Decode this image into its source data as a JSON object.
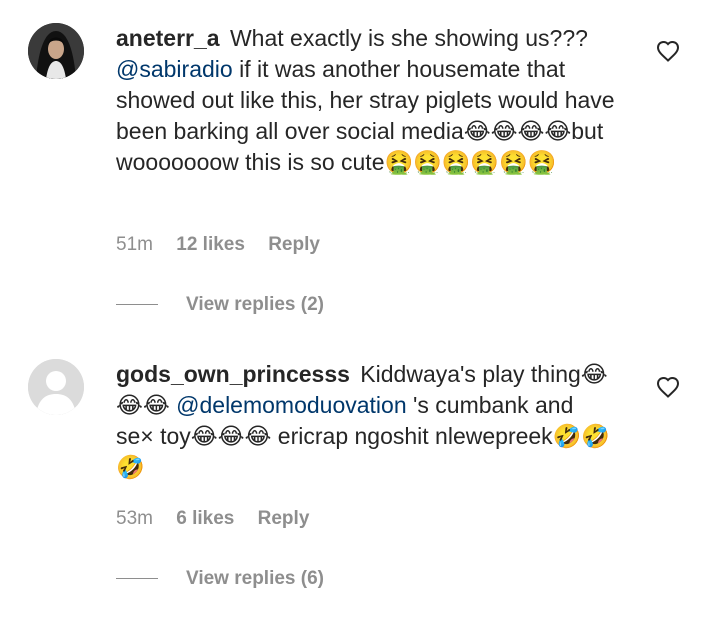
{
  "comments": [
    {
      "username": "aneterr_a",
      "text_before": " What exactly is she showing us??? ",
      "mention": "@sabiradio",
      "text_after": " if it was another housemate that showed out like this, her stray piglets would have been barking all over social media😂😂😂😂but wooooooow this is so cute🤮🤮🤮🤮🤮🤮",
      "time": "51m",
      "likes": "12 likes",
      "reply": "Reply",
      "view_replies": "View replies (2)"
    },
    {
      "username": "gods_own_princesss",
      "text_before": " Kiddwaya's play thing😂😂😂 ",
      "mention": "@delemomoduovation",
      "text_after": " 's cumbank and se× toy😂😂😂 ericrap ngoshit nlewepreek🤣🤣🤣",
      "time": "53m",
      "likes": "6 likes",
      "reply": "Reply",
      "view_replies": "View replies (6)"
    }
  ],
  "icons": {
    "like": "heart-outline-icon",
    "avatar_default": "default-avatar-icon"
  },
  "colors": {
    "text": "#262626",
    "secondary": "#8e8e8e",
    "mention": "#00376b"
  }
}
